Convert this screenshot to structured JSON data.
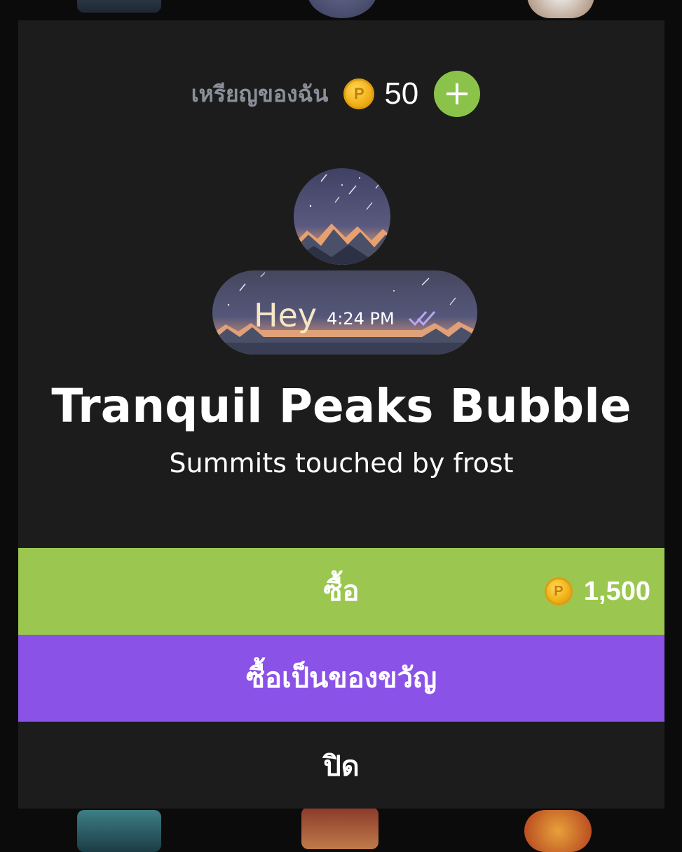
{
  "wallet": {
    "label": "เหรียญของฉัน",
    "balance": "50",
    "coin_icon_letter": "P",
    "add_icon": "plus-icon"
  },
  "preview": {
    "message_text": "Hey",
    "message_time": "4:24 PM",
    "read_icon": "double-check-icon"
  },
  "item": {
    "title": "Tranquil Peaks Bubble",
    "subtitle": "Summits touched by frost"
  },
  "actions": {
    "buy_label": "ซื้อ",
    "price": "1,500",
    "gift_label": "ซื้อเป็นของขวัญ",
    "close_label": "ปิด"
  },
  "colors": {
    "buy_button": "#9bc750",
    "gift_button": "#8b52e8",
    "add_button": "#8bc34a",
    "coin": "#f2b51c",
    "modal_background": "#1c1c1c"
  }
}
